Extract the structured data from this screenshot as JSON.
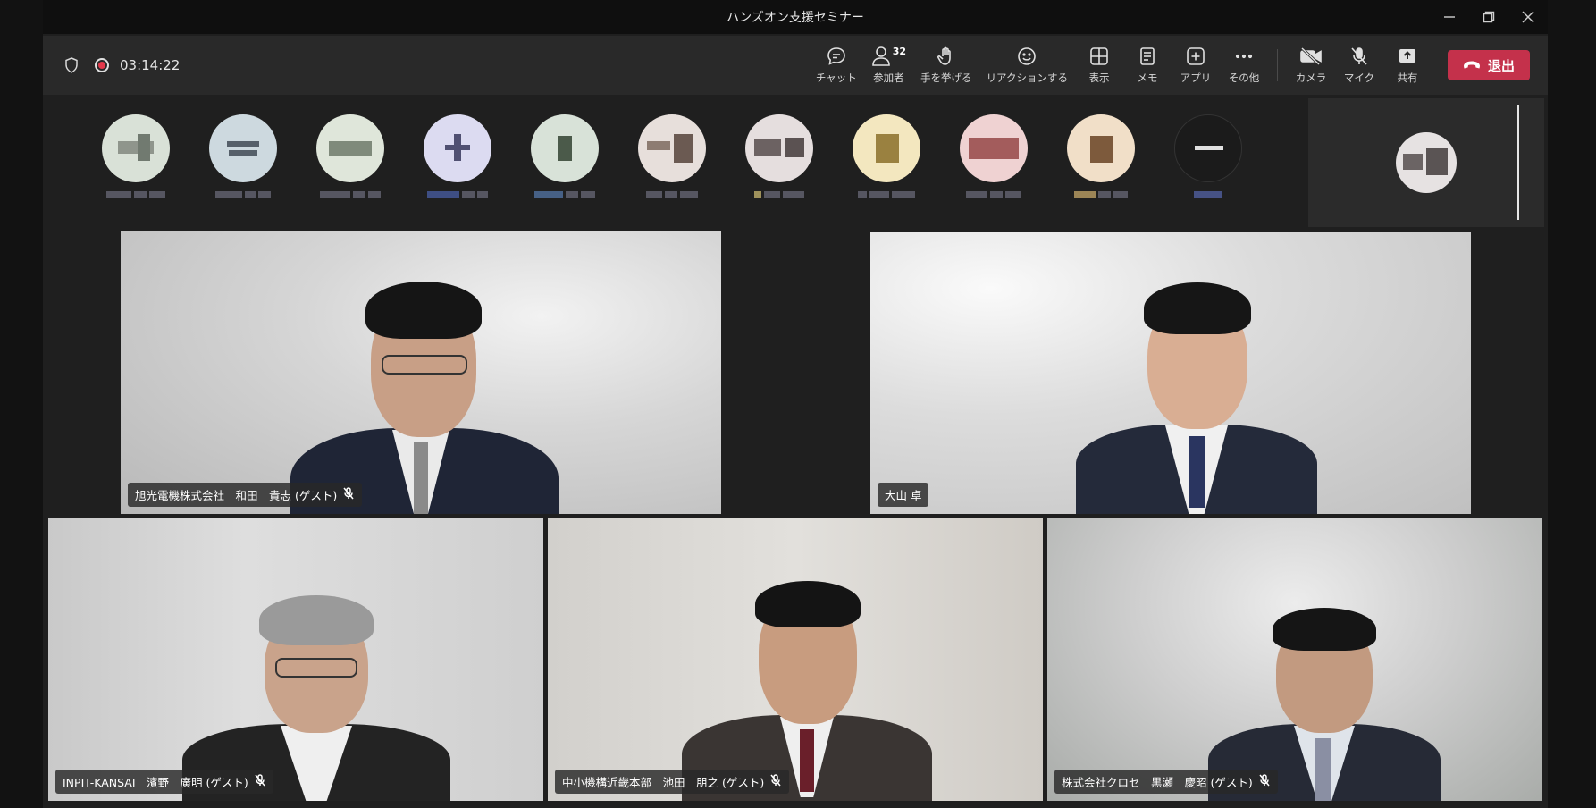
{
  "window": {
    "title": "ハンズオン支援セミナー"
  },
  "toolbar": {
    "timer": "03:14:22",
    "participants_count": "32",
    "items": [
      {
        "label": "チャット"
      },
      {
        "label": "参加者"
      },
      {
        "label": "手を挙げる"
      },
      {
        "label": "リアクションする"
      },
      {
        "label": "表示"
      },
      {
        "label": "メモ"
      },
      {
        "label": "アプリ"
      },
      {
        "label": "その他"
      },
      {
        "label": "カメラ"
      },
      {
        "label": "マイク"
      },
      {
        "label": "共有"
      }
    ],
    "leave_label": "退出"
  },
  "colors": {
    "leave": "#c4314b",
    "active_speaker": "#7f85f5",
    "recording": "#e3394b"
  },
  "tiles": [
    {
      "name": "旭光電機株式会社　和田　貴志 (ゲスト)",
      "muted": true
    },
    {
      "name": "大山 卓",
      "muted": false,
      "active": true
    },
    {
      "name": "INPIT-KANSAI　濱野　廣明 (ゲスト)",
      "muted": true
    },
    {
      "name": "中小機構近畿本部　池田　朋之 (ゲスト)",
      "muted": true
    },
    {
      "name": "株式会社クロセ　黒瀬　慶昭 (ゲスト)",
      "muted": true
    }
  ]
}
